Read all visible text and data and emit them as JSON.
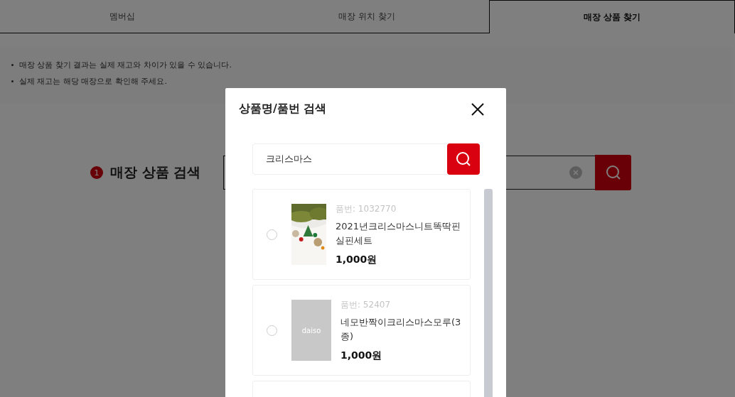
{
  "tabs": [
    {
      "label": "멤버십",
      "selected": false
    },
    {
      "label": "매장 위치 찾기",
      "selected": false
    },
    {
      "label": "매장 상품 찾기",
      "selected": true
    }
  ],
  "notices": [
    "매장 상품 찾기 결과는 실제 재고와 차이가 있을 수 있습니다.",
    "실제 재고는 해당 매장으로 확인해 주세요."
  ],
  "section": {
    "step": "1",
    "title": "매장 상품 검색"
  },
  "modal": {
    "title": "상품명/품번 검색",
    "search": {
      "value": "크리스마스"
    },
    "items": [
      {
        "code": "품번: 1032770",
        "name": "2021년크리스마스니트똑딱핀실핀세트",
        "price": "1,000원",
        "selected": false
      },
      {
        "code": "품번: 52407",
        "name": "네모반짝이크리스마스모루(3종)",
        "price": "1,000원",
        "selected": false,
        "image": {
          "kind": "placeholder",
          "label": "daiso"
        }
      }
    ]
  }
}
